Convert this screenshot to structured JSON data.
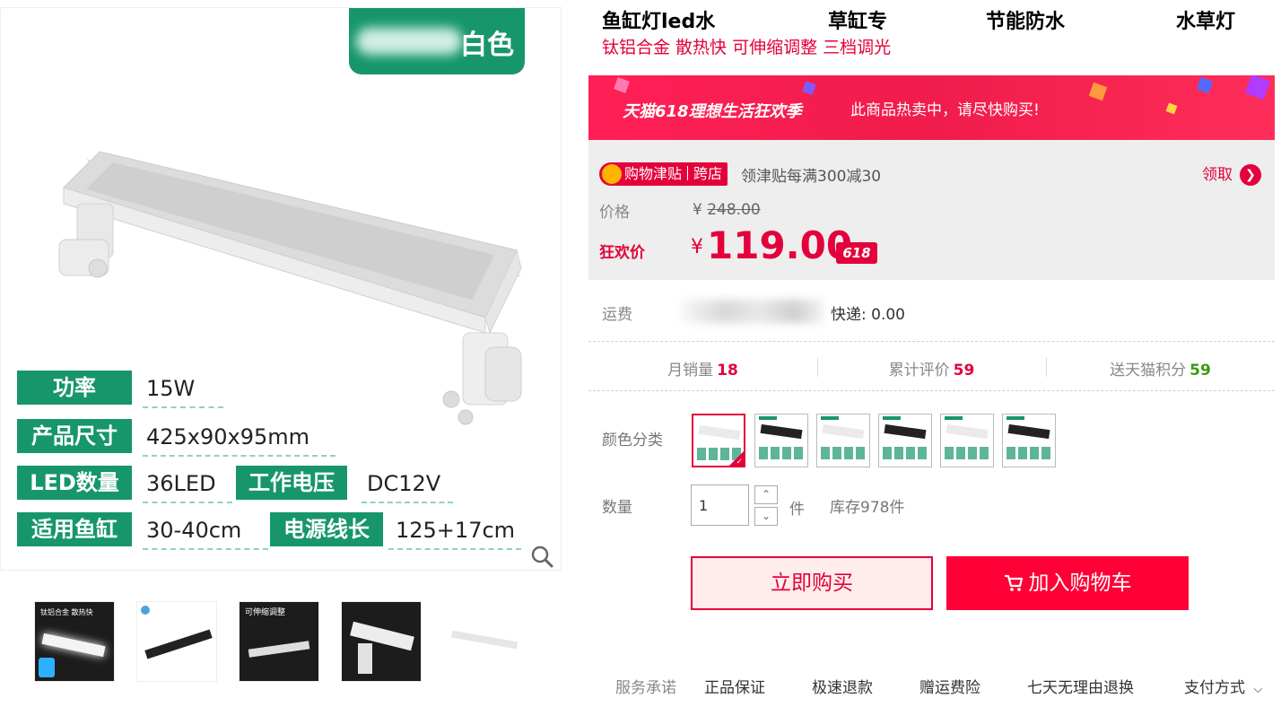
{
  "gallery": {
    "badge_text": "白色",
    "specs": [
      {
        "key": "功率",
        "value": "15W"
      },
      {
        "key": "产品尺寸",
        "value": "425x90x95mm"
      },
      {
        "key": "LED数量",
        "value": "36LED"
      },
      {
        "key": "工作电压",
        "value": "DC12V"
      },
      {
        "key": "适用鱼缸",
        "value": "30-40cm"
      },
      {
        "key": "电源线长",
        "value": "125+17cm"
      }
    ],
    "zoom_icon": "magnifier-icon",
    "thumbnails": [
      {
        "caption": "钛铝合金 散热快"
      },
      {
        "caption": ""
      },
      {
        "caption": "可伸缩调整"
      },
      {
        "caption": ""
      },
      {
        "caption": ""
      }
    ]
  },
  "product": {
    "title_parts": [
      "鱼缸灯led水",
      "草缸专",
      "节能防水",
      "水草灯"
    ],
    "subtitle": "钛铝合金 散热快 可伸缩调整 三档调光"
  },
  "promo": {
    "campaign": "天猫618理想生活狂欢季",
    "hot_text": "此商品热卖中，请尽快购买!",
    "coupon_tag": "购物津贴",
    "coupon_tag2": "跨店",
    "coupon_desc": "领津贴每满300减30",
    "claim_label": "领取",
    "claim_icon": "chevron-right-icon"
  },
  "price": {
    "label": "价格",
    "currency": "¥",
    "original": "248.00",
    "sale_label": "狂欢价",
    "sale": "119.00",
    "badge": "618"
  },
  "shipping": {
    "label": "运费",
    "text": "快递: 0.00"
  },
  "stats": [
    {
      "label": "月销量",
      "value": "18"
    },
    {
      "label": "累计评价",
      "value": "59"
    },
    {
      "label": "送天猫积分",
      "value": "59"
    }
  ],
  "sku": {
    "label": "颜色分类",
    "options": [
      {
        "name": "白色",
        "selected": true
      },
      {
        "name": "黑色",
        "selected": false
      },
      {
        "name": "白色",
        "selected": false
      },
      {
        "name": "黑色",
        "selected": false
      },
      {
        "name": "白色",
        "selected": false
      },
      {
        "name": "黑色",
        "selected": false
      }
    ]
  },
  "quantity": {
    "label": "数量",
    "value": "1",
    "unit": "件",
    "stock": "库存978件"
  },
  "actions": {
    "buy_now": "立即购买",
    "add_cart": "加入购物车",
    "cart_icon": "cart-icon"
  },
  "services": {
    "label": "服务承诺",
    "items": [
      "正品保证",
      "极速退款",
      "赠运费险",
      "七天无理由退换"
    ],
    "payment": "支付方式"
  },
  "colors": {
    "brand_red": "#e4003a",
    "cart_red": "#ff0036",
    "spec_green": "#17966b",
    "points_green": "#3c9a10"
  }
}
